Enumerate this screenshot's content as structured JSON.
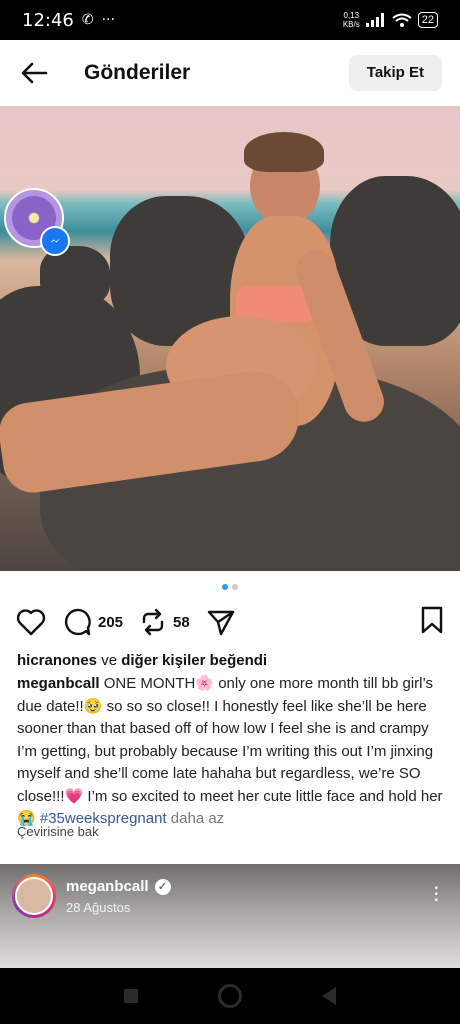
{
  "status_bar": {
    "time": "12:46",
    "net_speed_value": "0,13",
    "net_speed_unit": "KB/s",
    "battery": "22"
  },
  "header": {
    "title": "Gönderiler",
    "follow_label": "Takip Et"
  },
  "post": {
    "carousel": {
      "total": 2,
      "active": 1
    },
    "actions": {
      "comments": "205",
      "reposts": "58"
    },
    "likes": {
      "user": "hicranones",
      "connector": "ve",
      "others": "diğer kişiler beğendi"
    },
    "caption": {
      "username": "meganbcall",
      "text_1": "ONE MONTH🌸 only one more month till bb girl’s due date!!🥹 so so so close!! I honestly feel like she’ll be here sooner than that based off of how low I feel she is and crampy I’m getting, but probably because I’m writing this out I’m jinxing myself and she’ll come late hahaha but regardless, we’re SO close!!!💗 I’m so excited to meet her cute little face and hold her😭",
      "hashtag": "#35weekspregnant",
      "less_label": "daha az"
    },
    "translate_label": "Çevirisine bak"
  },
  "next_post": {
    "username": "meganbcall",
    "date": "28 Ağustos"
  }
}
